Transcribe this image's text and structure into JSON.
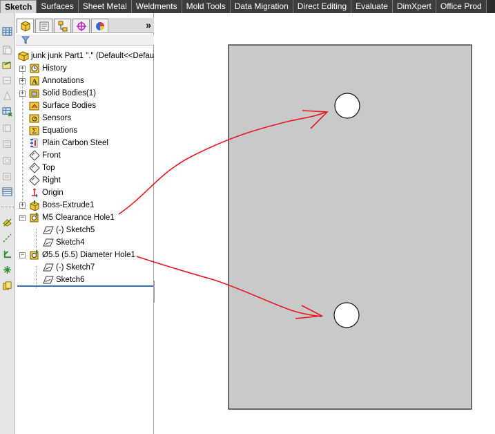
{
  "command_tabs": [
    "Sketch",
    "Surfaces",
    "Sheet Metal",
    "Weldments",
    "Mold Tools",
    "Data Migration",
    "Direct Editing",
    "Evaluate",
    "DimXpert",
    "Office Prod"
  ],
  "active_tab": "Sketch",
  "panel": {
    "tab_icons": [
      "feature-manager-icon",
      "property-manager-icon",
      "configuration-manager-icon",
      "dimxpert-manager-icon",
      "display-manager-icon"
    ],
    "more_glyph": "»",
    "filter_icon": "filter-icon"
  },
  "tree": {
    "root": "junk junk Part1 \".\" (Default<<Defau",
    "items": [
      {
        "label": "History",
        "icon": "history-icon"
      },
      {
        "label": "Annotations",
        "icon": "annotations-icon"
      },
      {
        "label": "Solid Bodies(1)",
        "icon": "solid-bodies-icon"
      },
      {
        "label": "Surface Bodies",
        "icon": "surface-bodies-icon"
      },
      {
        "label": "Sensors",
        "icon": "sensors-icon"
      },
      {
        "label": "Equations",
        "icon": "equations-icon"
      },
      {
        "label": "Plain Carbon Steel",
        "icon": "material-icon"
      },
      {
        "label": "Front",
        "icon": "plane-icon"
      },
      {
        "label": "Top",
        "icon": "plane-icon"
      },
      {
        "label": "Right",
        "icon": "plane-icon"
      },
      {
        "label": "Origin",
        "icon": "origin-icon"
      },
      {
        "label": "Boss-Extrude1",
        "icon": "extrude-icon"
      },
      {
        "label": "M5 Clearance Hole1",
        "icon": "hole-wizard-icon"
      },
      {
        "label": "(-) Sketch5",
        "icon": "sketch-icon"
      },
      {
        "label": "Sketch4",
        "icon": "sketch-icon"
      },
      {
        "label": "Ø5.5 (5.5) Diameter Hole1",
        "icon": "hole-wizard-icon"
      },
      {
        "label": "(-) Sketch7",
        "icon": "sketch-icon"
      },
      {
        "label": "Sketch6",
        "icon": "sketch-icon"
      }
    ]
  },
  "colors": {
    "tab_bar": "#2b2b2b",
    "part_face": "#c8c9c9",
    "annotation": "#e8141e",
    "rollback_bar": "#3a6fc2"
  }
}
